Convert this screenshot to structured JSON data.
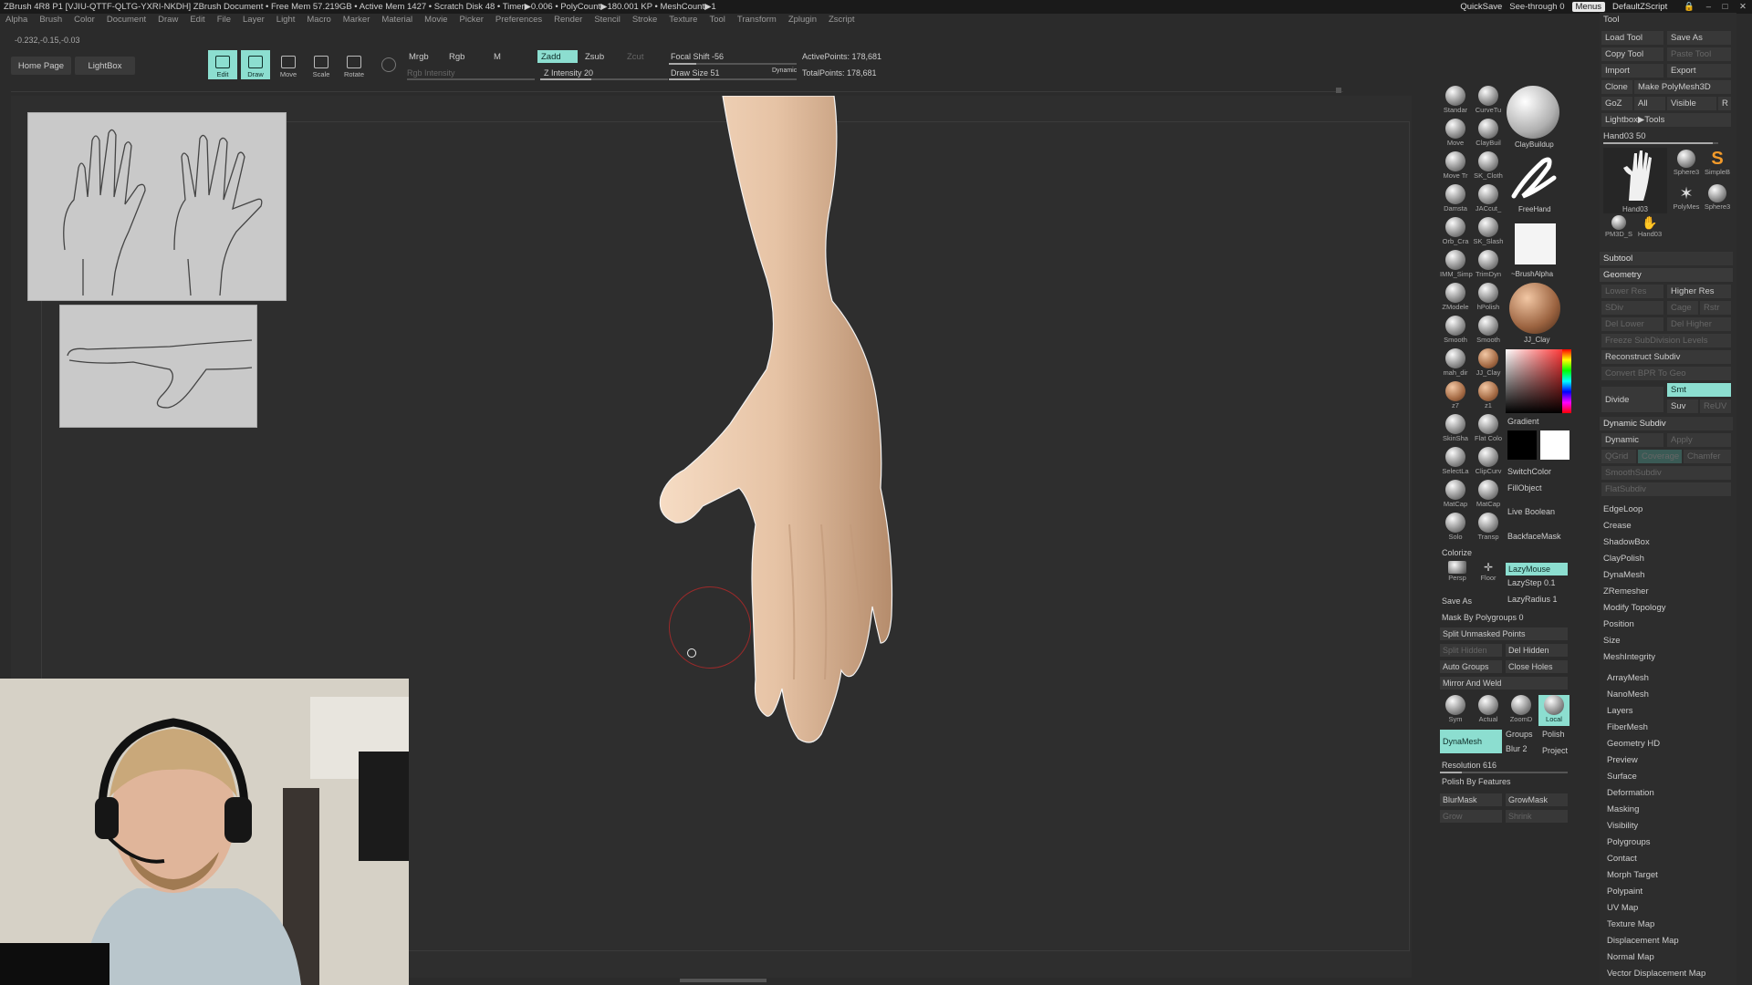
{
  "titlebar": {
    "info": "ZBrush 4R8 P1 [VJIU-QTTF-QLTG-YXRI-NKDH]   ZBrush Document     • Free Mem 57.219GB • Active Mem 1427 • Scratch Disk 48 • Timer▶0.006 • PolyCount▶180.001 KP • MeshCount▶1",
    "quicksave": "QuickSave",
    "seethrough": "See-through  0",
    "menus": "Menus",
    "script": "DefaultZScript"
  },
  "menubar": [
    "Alpha",
    "Brush",
    "Color",
    "Document",
    "Draw",
    "Edit",
    "File",
    "Layer",
    "Light",
    "Macro",
    "Marker",
    "Material",
    "Movie",
    "Picker",
    "Preferences",
    "Render",
    "Stencil",
    "Stroke",
    "Texture",
    "Tool",
    "Transform",
    "Zplugin",
    "Zscript"
  ],
  "coords": "-0.232,-0.15,-0.03",
  "topbar": {
    "home_page": "Home Page",
    "lightbox": "LightBox",
    "tools": [
      {
        "label": "Edit",
        "active": true
      },
      {
        "label": "Draw",
        "active": true
      },
      {
        "label": "Move",
        "active": false
      },
      {
        "label": "Scale",
        "active": false
      },
      {
        "label": "Rotate",
        "active": false
      }
    ],
    "mrgb": "Mrgb",
    "rgb": "Rgb",
    "m": "M",
    "rgb_intensity": "Rgb Intensity",
    "zadd": "Zadd",
    "zsub": "Zsub",
    "zcut": "Zcut",
    "z_intensity": "Z Intensity 20",
    "focal_shift": "Focal Shift -56",
    "draw_size": "Draw Size 51",
    "dynamic": "Dynamic",
    "active_points": "ActivePoints: 178,681",
    "total_points": "TotalPoints: 178,681"
  },
  "brushes": {
    "grid": [
      [
        "Standar",
        "CurveTu"
      ],
      [
        "Move",
        "ClayBuil"
      ],
      [
        "Move Tr",
        "SK_Cloth"
      ],
      [
        "Damsta",
        "JACcut_"
      ],
      [
        "Orb_Cra",
        "SK_Slash"
      ],
      [
        "IMM_Simp",
        "TrimDyn"
      ],
      [
        "ZModele",
        "hPolish"
      ],
      [
        "Smooth",
        "Smooth"
      ],
      [
        "mah_dir",
        "JJ_Clay"
      ],
      [
        "z7",
        "z1"
      ],
      [
        "SkinSha",
        "Flat Colo"
      ],
      [
        "SelectLa",
        "ClipCurv"
      ],
      [
        "MatCap",
        "MatCap"
      ],
      [
        "Solo",
        "Transp"
      ]
    ],
    "claybuildup": "ClayBuildup",
    "freehand": "FreeHand",
    "brushalpha": "~BrushAlpha",
    "jj_clay": "JJ_Clay",
    "gradient": "Gradient",
    "switchcolor": "SwitchColor",
    "fillobject": "FillObject",
    "live_boolean": "Live Boolean",
    "backfacemask": "BackfaceMask",
    "colorize": "Colorize",
    "persp": "Persp",
    "floor": "Floor",
    "lazymouse": "LazyMouse",
    "lazystep": "LazyStep 0.1",
    "lazyradius": "LazyRadius 1",
    "save_as": "Save As",
    "mask_by_polygroups": "Mask By Polygroups 0",
    "split_unmasked": "Split Unmasked Points",
    "split_hidden": "Split Hidden",
    "del_hidden": "Del Hidden",
    "auto_groups": "Auto Groups",
    "close_holes": "Close Holes",
    "mirror_weld": "Mirror And Weld",
    "icons_row": [
      "Sym",
      "Actual",
      "ZoomD",
      "Local"
    ],
    "dynamesh": "DynaMesh",
    "groups": "Groups",
    "polish": "Polish",
    "blur": "Blur 2",
    "project": "Project",
    "resolution": "Resolution 616",
    "polish_by_features": "Polish By Features",
    "blurmask": "BlurMask",
    "growmask": "GrowMask",
    "grow": "Grow",
    "shrink": "Shrink"
  },
  "toolpanel": {
    "title": "Tool",
    "load_tool": "Load Tool",
    "save_as": "Save As",
    "copy_tool": "Copy Tool",
    "paste_tool": "Paste Tool",
    "import": "Import",
    "export": "Export",
    "clone": "Clone",
    "make_polymesh": "Make PolyMesh3D",
    "goz": "GoZ",
    "all": "All",
    "visible": "Visible",
    "r": "R",
    "lightbox_tools": "Lightbox▶Tools",
    "hand_slider": "Hand03  50",
    "thumbs": [
      "Hand03",
      "Sphere3",
      "SimpleB",
      "PolyMes",
      "Sphere3",
      "PM3D_S",
      "Hand03"
    ],
    "subtool": "Subtool",
    "geometry": "Geometry",
    "lower_res": "Lower Res",
    "higher_res": "Higher Res",
    "sdiv": "SDiv",
    "cage": "Cage",
    "rstr": "Rstr",
    "del_lower": "Del Lower",
    "del_higher": "Del Higher",
    "freeze_subdiv": "Freeze SubDivision Levels",
    "reconstruct_subdiv": "Reconstruct Subdiv",
    "convert_bpr": "Convert BPR To Geo",
    "divide": "Divide",
    "smt": "Smt",
    "suv": "Suv",
    "reuv": "ReUV",
    "dynamic_subdiv": "Dynamic Subdiv",
    "dynamic": "Dynamic",
    "apply": "Apply",
    "qgrid": "QGrid",
    "coverage": "Coverage",
    "chamfer": "Chamfer",
    "smooth_subdiv": "SmoothSubdiv",
    "flat_subdiv": "FlatSubdiv",
    "edgeloop": "EdgeLoop",
    "crease": "Crease",
    "shadowbox": "ShadowBox",
    "claypolish": "ClayPolish",
    "dynamesh": "DynaMesh",
    "zremesher": "ZRemesher",
    "modify_topology": "Modify Topology",
    "position": "Position",
    "size": "Size",
    "meshintegrity": "MeshIntegrity",
    "sections": [
      "ArrayMesh",
      "NanoMesh",
      "Layers",
      "FiberMesh",
      "Geometry HD",
      "Preview",
      "Surface",
      "Deformation",
      "Masking",
      "Visibility",
      "Polygroups",
      "Contact",
      "Morph Target",
      "Polypaint",
      "UV Map",
      "Texture Map",
      "Displacement Map",
      "Normal Map",
      "Vector Displacement Map"
    ]
  },
  "colors": {
    "accent": "#8cded0",
    "skin": "#e8c7aa",
    "background": "#2b2b2b",
    "cursor_ring": "#b02020"
  }
}
